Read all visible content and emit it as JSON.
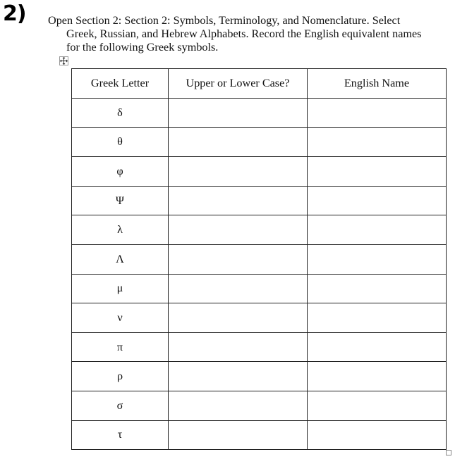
{
  "question_number": "2)",
  "instructions": {
    "line1": "Open Section 2: Section 2: Symbols, Terminology, and Nomenclature.  Select",
    "line2": "Greek, Russian, and Hebrew Alphabets.  Record the English equivalent names",
    "line3": "for the following Greek symbols."
  },
  "icons": {
    "move_handle": "move-arrows-icon",
    "resize_handle": "resize-square-icon"
  },
  "table": {
    "headers": [
      "Greek Letter",
      "Upper or Lower Case?",
      "English Name"
    ],
    "rows": [
      {
        "letter": "δ",
        "case": "",
        "name": ""
      },
      {
        "letter": "θ",
        "case": "",
        "name": ""
      },
      {
        "letter": "φ",
        "case": "",
        "name": ""
      },
      {
        "letter": "Ψ",
        "case": "",
        "name": ""
      },
      {
        "letter": "λ",
        "case": "",
        "name": ""
      },
      {
        "letter": "Λ",
        "case": "",
        "name": ""
      },
      {
        "letter": "μ",
        "case": "",
        "name": ""
      },
      {
        "letter": "ν",
        "case": "",
        "name": ""
      },
      {
        "letter": "π",
        "case": "",
        "name": ""
      },
      {
        "letter": "ρ",
        "case": "",
        "name": ""
      },
      {
        "letter": "σ",
        "case": "",
        "name": ""
      },
      {
        "letter": "τ",
        "case": "",
        "name": ""
      }
    ]
  }
}
